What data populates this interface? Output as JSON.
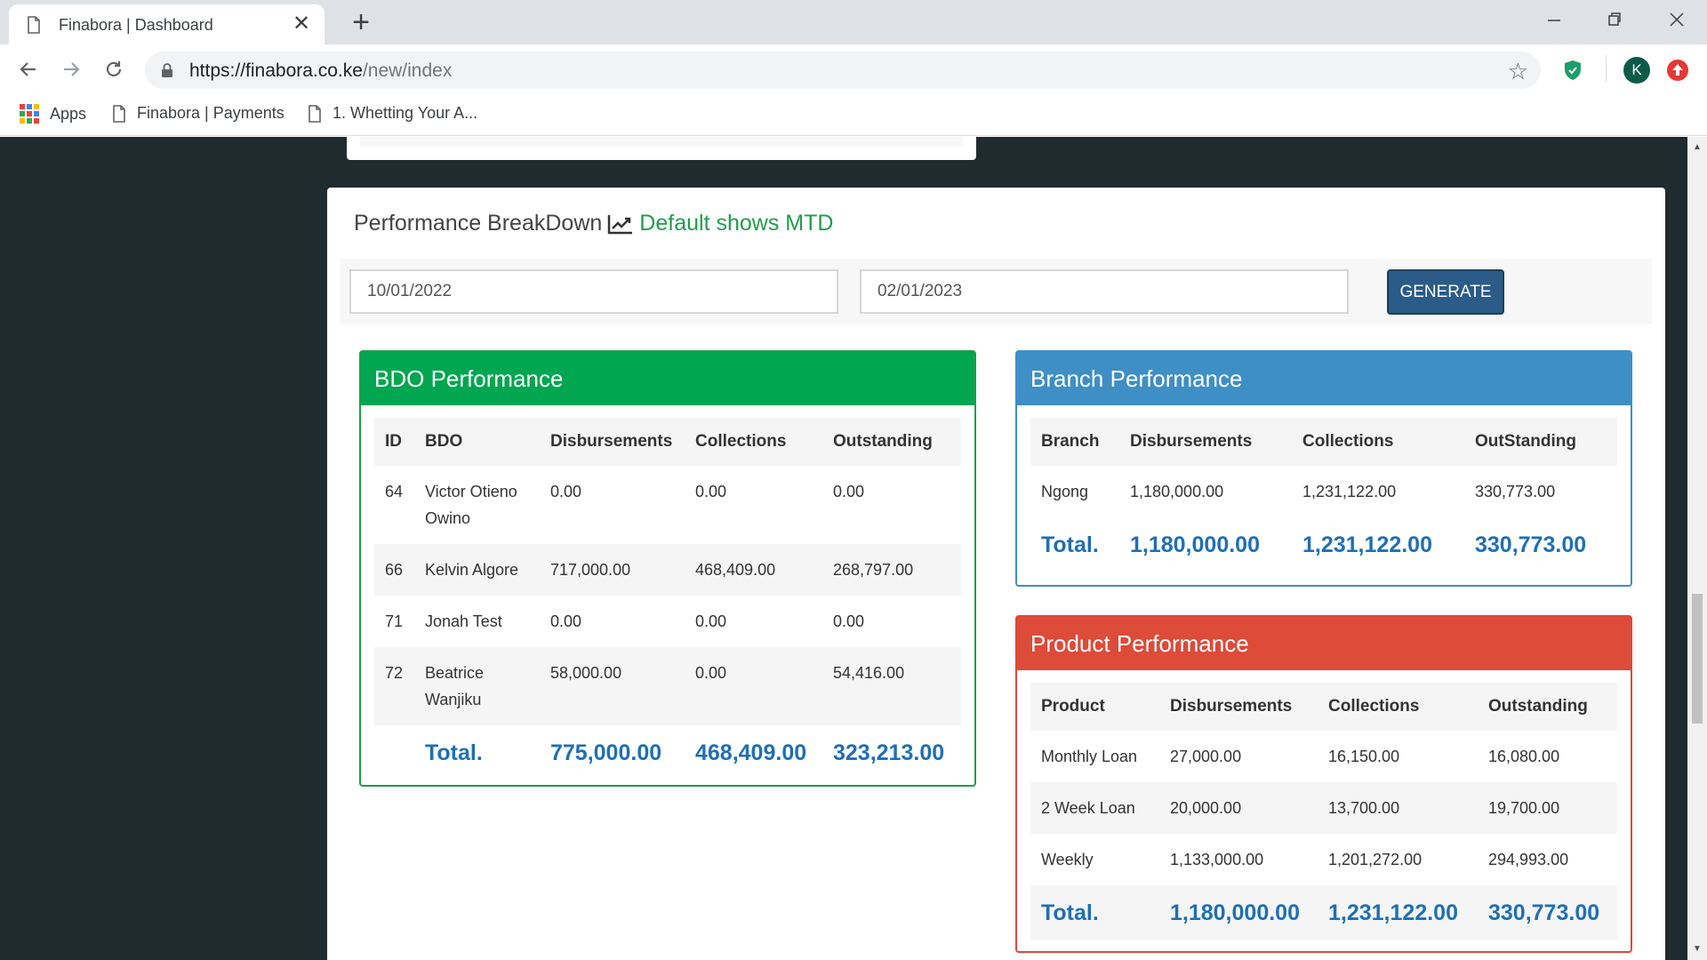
{
  "browser": {
    "tab_title": "Finabora | Dashboard",
    "new_tab_symbol": "+",
    "url_domain": "https://finabora.co.ke",
    "url_path": "/new/index",
    "profile_letter": "K",
    "bookmarks": [
      "Apps",
      "Finabora | Payments",
      "1. Whetting Your A..."
    ]
  },
  "performance": {
    "title": "Performance BreakDown",
    "subtitle": "Default shows MTD",
    "start_date": "10/01/2022",
    "end_date": "02/01/2023",
    "generate_label": "GENERATE"
  },
  "bdo": {
    "title": "BDO Performance",
    "headers": [
      "ID",
      "BDO",
      "Disbursements",
      "Collections",
      "Outstanding"
    ],
    "rows": [
      [
        "64",
        "Victor Otieno Owino",
        "0.00",
        "0.00",
        "0.00"
      ],
      [
        "66",
        "Kelvin Algore",
        "717,000.00",
        "468,409.00",
        "268,797.00"
      ],
      [
        "71",
        "Jonah Test",
        "0.00",
        "0.00",
        "0.00"
      ],
      [
        "72",
        "Beatrice Wanjiku",
        "58,000.00",
        "0.00",
        "54,416.00"
      ]
    ],
    "total": [
      "",
      "Total.",
      "775,000.00",
      "468,409.00",
      "323,213.00"
    ]
  },
  "branch": {
    "title": "Branch Performance",
    "headers": [
      "Branch",
      "Disbursements",
      "Collections",
      "OutStanding"
    ],
    "rows": [
      [
        "Ngong",
        "1,180,000.00",
        "1,231,122.00",
        "330,773.00"
      ]
    ],
    "total": [
      "Total.",
      "1,180,000.00",
      "1,231,122.00",
      "330,773.00"
    ]
  },
  "product": {
    "title": "Product Performance",
    "headers": [
      "Product",
      "Disbursements",
      "Collections",
      "Outstanding"
    ],
    "rows": [
      [
        "Monthly Loan",
        "27,000.00",
        "16,150.00",
        "16,080.00"
      ],
      [
        "2 Week Loan",
        "20,000.00",
        "13,700.00",
        "19,700.00"
      ],
      [
        "Weekly",
        "1,133,000.00",
        "1,201,272.00",
        "294,993.00"
      ]
    ],
    "total": [
      "Total.",
      "1,180,000.00",
      "1,231,122.00",
      "330,773.00"
    ]
  }
}
